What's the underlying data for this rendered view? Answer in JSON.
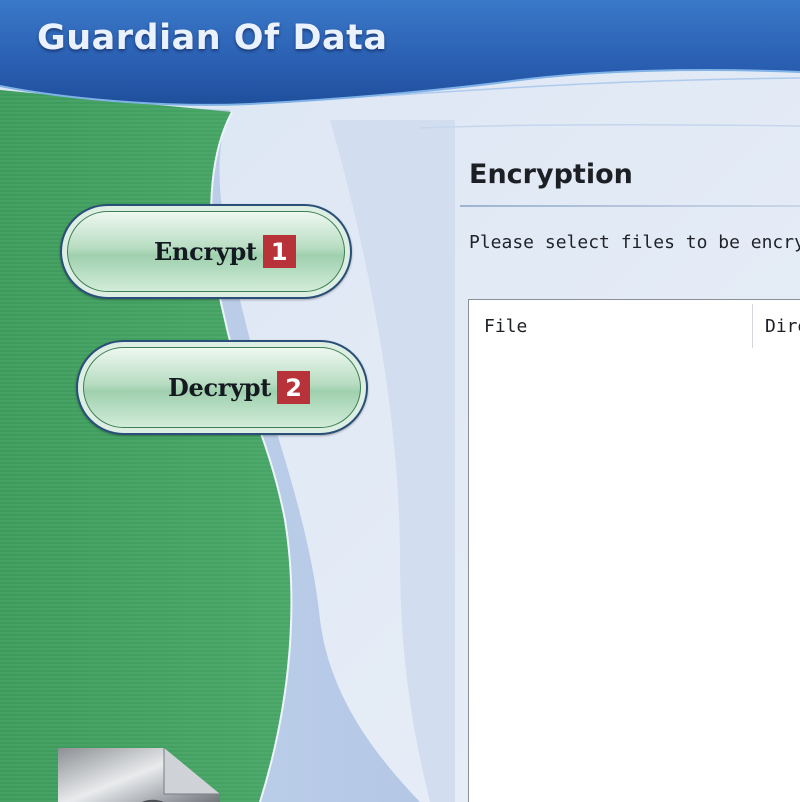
{
  "header": {
    "app_title": "Guardian Of Data"
  },
  "nav": {
    "items": [
      {
        "label": "Encrypt",
        "badge": "1"
      },
      {
        "label": "Decrypt",
        "badge": "2"
      }
    ]
  },
  "main": {
    "section_title": "Encryption",
    "instructions": "Please select files to be encrypte",
    "file_list": {
      "columns": [
        "File",
        "Dire"
      ],
      "rows": []
    }
  },
  "colors": {
    "header_blue": "#2a5fb0",
    "sidebar_green": "#3e9d5e",
    "badge_red": "#b8323a",
    "panel_bg": "#e8eef7"
  },
  "icons": {
    "document": "document-icon"
  }
}
